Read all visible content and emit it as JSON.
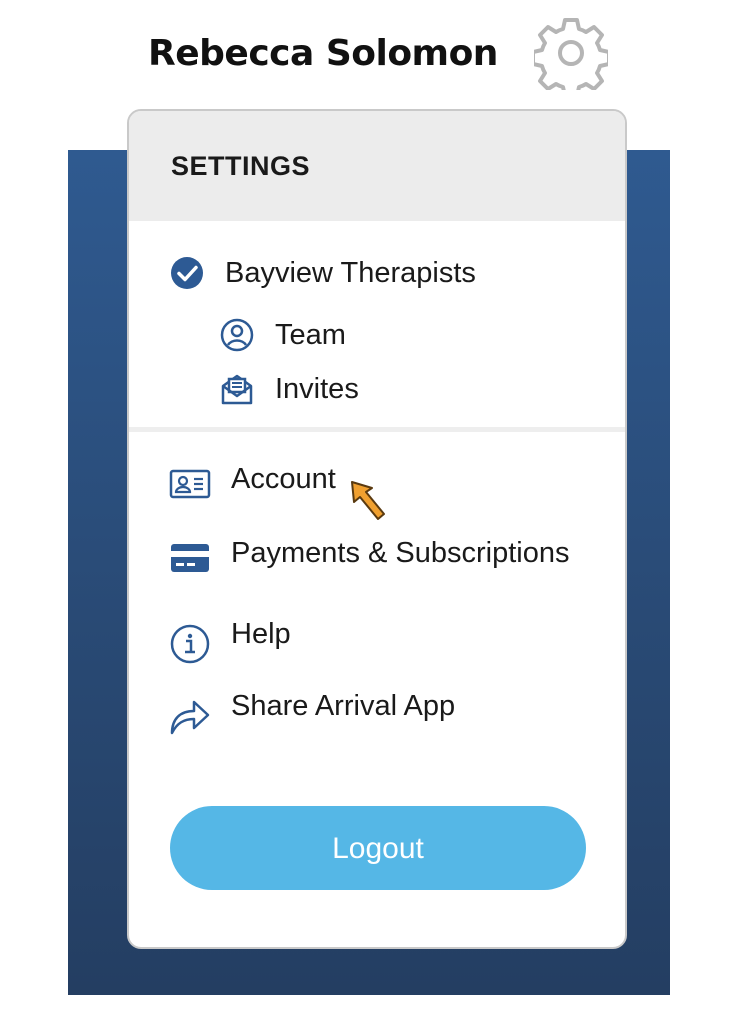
{
  "header": {
    "user_name": "Rebecca Solomon",
    "settings_icon": "gear-icon"
  },
  "panel": {
    "title": "SETTINGS",
    "organization": {
      "name": "Bayview Therapists",
      "icon": "check-circle-icon",
      "icon_color": "#2d5a94"
    },
    "org_items": [
      {
        "label": "Team",
        "icon": "user-circle-icon"
      },
      {
        "label": "Invites",
        "icon": "envelope-open-icon"
      }
    ],
    "menu_items": [
      {
        "label": "Account",
        "icon": "id-card-icon"
      },
      {
        "label": "Payments & Subscriptions",
        "icon": "credit-card-icon"
      },
      {
        "label": "Help",
        "icon": "info-icon"
      },
      {
        "label": "Share Arrival App",
        "icon": "share-arrow-icon"
      }
    ],
    "logout_label": "Logout"
  },
  "colors": {
    "accent_blue": "#2d5a94",
    "logout_button": "#55b7e6",
    "backdrop_top": "#2f5a90",
    "backdrop_bottom": "#243e62",
    "pointer_arrow": "#f0a030"
  }
}
